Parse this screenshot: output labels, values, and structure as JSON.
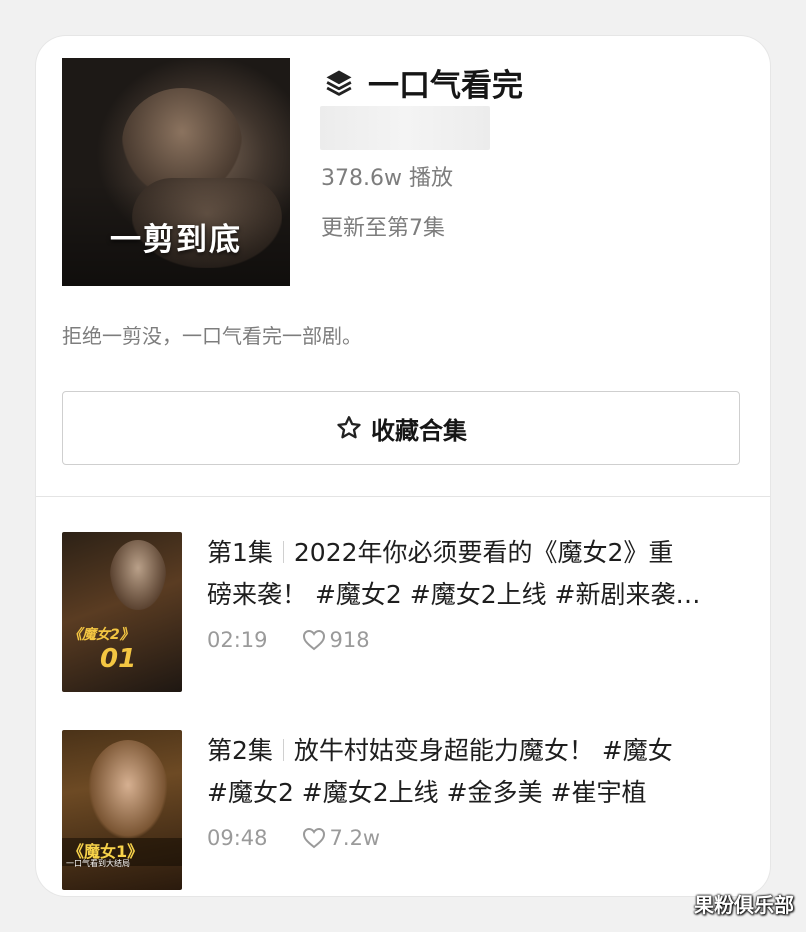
{
  "collection": {
    "title": "一口气看完",
    "cover_text": "一剪到底",
    "plays": "378.6w 播放",
    "update_status": "更新至第7集",
    "description": "拒绝一剪没，一口气看完一部剧。",
    "favorite_button": "收藏合集"
  },
  "episodes": [
    {
      "number": "第1集",
      "title_line1": "2022年你必须要看的《魔女2》重",
      "title_line2": "磅来袭！ #魔女2 #魔女2上线 #新剧来袭…",
      "duration": "02:19",
      "likes": "918",
      "thumb_title": "《魔女2》",
      "thumb_num": "01"
    },
    {
      "number": "第2集",
      "title_line1": "放牛村姑变身超能力魔女！ #魔女",
      "title_line2": "#魔女2 #魔女2上线 #金多美  #崔宇植",
      "duration": "09:48",
      "likes": "7.2w",
      "thumb_title": "《魔女1》",
      "thumb_sub": "一口气看到大结局"
    }
  ],
  "watermark": "果粉俱乐部",
  "icons": [
    "layers-icon",
    "star-outline-icon",
    "heart-outline-icon"
  ]
}
